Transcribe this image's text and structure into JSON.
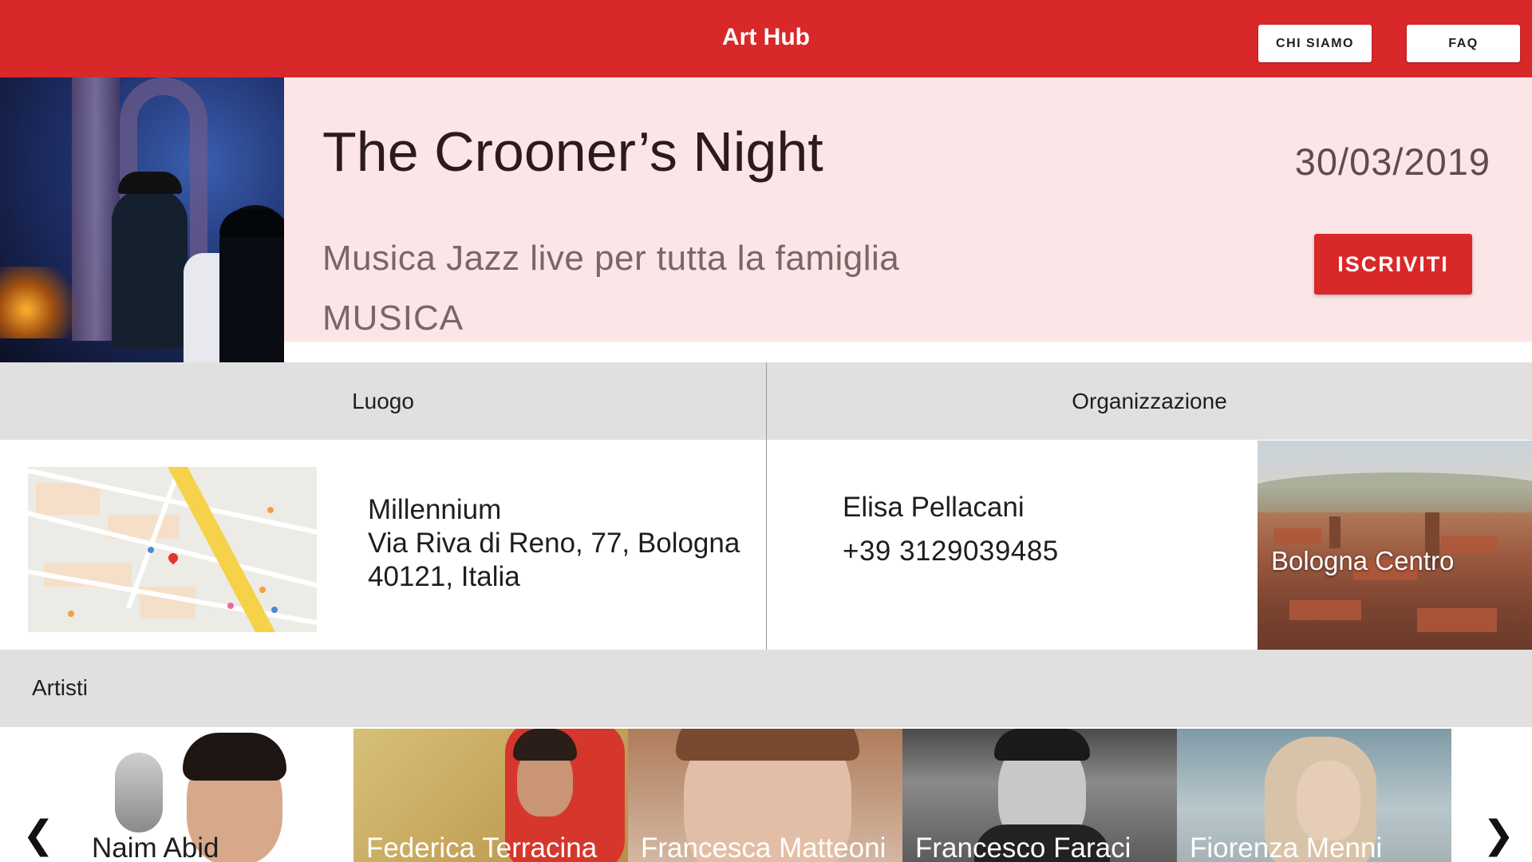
{
  "header": {
    "app_title": "Art Hub",
    "nav": [
      "CHI SIAMO",
      "FAQ"
    ],
    "brand_color": "#d9282a"
  },
  "event": {
    "title": "The Crooner’s Night",
    "date": "30/03/2019",
    "subtitle": "Musica Jazz live per tutta la famiglia",
    "category": "MUSICA",
    "cta_label": "ISCRIVITI"
  },
  "luogo": {
    "heading": "Luogo",
    "name": "Millennium",
    "street": "Via Riva di Reno, 77, Bologna",
    "postcode_country": "40121, Italia"
  },
  "organizzazione": {
    "heading": "Organizzazione",
    "contact_name": "Elisa Pellacani",
    "phone": "+39 3129039485",
    "city_label": "Bologna Centro"
  },
  "artisti": {
    "heading": "Artisti",
    "items": [
      {
        "name": "Naim Abid"
      },
      {
        "name": "Federica Terracina"
      },
      {
        "name": "Francesca Matteoni"
      },
      {
        "name": "Francesco Faraci"
      },
      {
        "name": "Fiorenza Menni"
      }
    ]
  }
}
